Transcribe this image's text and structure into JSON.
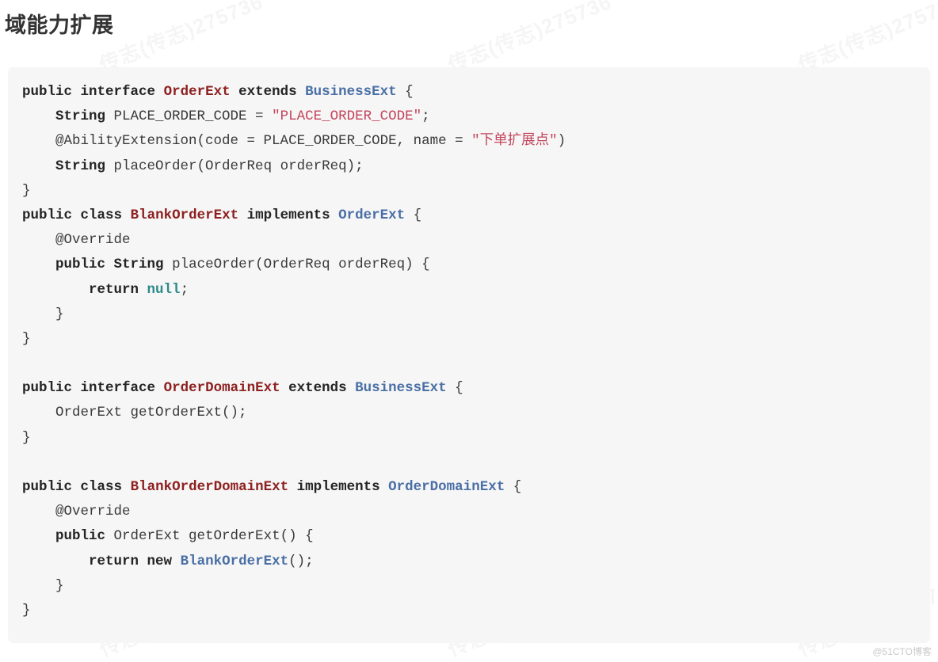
{
  "page": {
    "title": "域能力扩展",
    "footer_watermark": "@51CTO博客",
    "watermark_text": "传志(传志)275736",
    "background_color": "#ffffff",
    "code_background_color": "#f6f6f6"
  },
  "theme": {
    "title_color": "#333333",
    "code_text_color": "#303030",
    "keyword_color": "#242424",
    "declared_type_color": "#8e2020",
    "referenced_type_color": "#4a6fa5",
    "string_color": "#c4455c",
    "null_literal_color": "#2f8a8a"
  },
  "code": {
    "language": "java",
    "lines": [
      {
        "id": "l1",
        "tokens": [
          {
            "t": "public",
            "c": "kw"
          },
          {
            "t": " ",
            "c": "plain"
          },
          {
            "t": "interface",
            "c": "kw"
          },
          {
            "t": " ",
            "c": "plain"
          },
          {
            "t": "OrderExt",
            "c": "decl"
          },
          {
            "t": " ",
            "c": "plain"
          },
          {
            "t": "extends",
            "c": "kw"
          },
          {
            "t": " ",
            "c": "plain"
          },
          {
            "t": "BusinessExt",
            "c": "type"
          },
          {
            "t": " {",
            "c": "punct"
          }
        ]
      },
      {
        "id": "l2",
        "tokens": [
          {
            "t": "    ",
            "c": "plain"
          },
          {
            "t": "String",
            "c": "kw"
          },
          {
            "t": " PLACE_ORDER_CODE = ",
            "c": "plain"
          },
          {
            "t": "\"PLACE_ORDER_CODE\"",
            "c": "str"
          },
          {
            "t": ";",
            "c": "punct"
          }
        ]
      },
      {
        "id": "l3",
        "tokens": [
          {
            "t": "    ",
            "c": "plain"
          },
          {
            "t": "@AbilityExtension(code = PLACE_ORDER_CODE, name = ",
            "c": "anno"
          },
          {
            "t": "\"下单扩展点\"",
            "c": "str"
          },
          {
            "t": ")",
            "c": "punct"
          }
        ]
      },
      {
        "id": "l4",
        "tokens": [
          {
            "t": "    ",
            "c": "plain"
          },
          {
            "t": "String",
            "c": "kw"
          },
          {
            "t": " placeOrder(OrderReq orderReq);",
            "c": "plain"
          }
        ]
      },
      {
        "id": "l5",
        "tokens": [
          {
            "t": "}",
            "c": "punct"
          }
        ]
      },
      {
        "id": "l6",
        "tokens": [
          {
            "t": "public",
            "c": "kw"
          },
          {
            "t": " ",
            "c": "plain"
          },
          {
            "t": "class",
            "c": "kw"
          },
          {
            "t": " ",
            "c": "plain"
          },
          {
            "t": "BlankOrderExt",
            "c": "decl"
          },
          {
            "t": " ",
            "c": "plain"
          },
          {
            "t": "implements",
            "c": "kw"
          },
          {
            "t": " ",
            "c": "plain"
          },
          {
            "t": "OrderExt",
            "c": "type"
          },
          {
            "t": " {",
            "c": "punct"
          }
        ]
      },
      {
        "id": "l7",
        "tokens": [
          {
            "t": "    ",
            "c": "plain"
          },
          {
            "t": "@Override",
            "c": "anno"
          }
        ]
      },
      {
        "id": "l8",
        "tokens": [
          {
            "t": "    ",
            "c": "plain"
          },
          {
            "t": "public",
            "c": "kw"
          },
          {
            "t": " ",
            "c": "plain"
          },
          {
            "t": "String",
            "c": "kw"
          },
          {
            "t": " placeOrder(OrderReq orderReq) {",
            "c": "plain"
          }
        ]
      },
      {
        "id": "l9",
        "tokens": [
          {
            "t": "        ",
            "c": "plain"
          },
          {
            "t": "return",
            "c": "kw"
          },
          {
            "t": " ",
            "c": "plain"
          },
          {
            "t": "null",
            "c": "null"
          },
          {
            "t": ";",
            "c": "punct"
          }
        ]
      },
      {
        "id": "l10",
        "tokens": [
          {
            "t": "    }",
            "c": "punct"
          }
        ]
      },
      {
        "id": "l11",
        "tokens": [
          {
            "t": "}",
            "c": "punct"
          }
        ]
      },
      {
        "id": "l12",
        "tokens": [
          {
            "t": "",
            "c": "plain"
          }
        ]
      },
      {
        "id": "l13",
        "tokens": [
          {
            "t": "public",
            "c": "kw"
          },
          {
            "t": " ",
            "c": "plain"
          },
          {
            "t": "interface",
            "c": "kw"
          },
          {
            "t": " ",
            "c": "plain"
          },
          {
            "t": "OrderDomainExt",
            "c": "decl"
          },
          {
            "t": " ",
            "c": "plain"
          },
          {
            "t": "extends",
            "c": "kw"
          },
          {
            "t": " ",
            "c": "plain"
          },
          {
            "t": "BusinessExt",
            "c": "type"
          },
          {
            "t": " {",
            "c": "punct"
          }
        ]
      },
      {
        "id": "l14",
        "tokens": [
          {
            "t": "    OrderExt getOrderExt();",
            "c": "plain"
          }
        ]
      },
      {
        "id": "l15",
        "tokens": [
          {
            "t": "}",
            "c": "punct"
          }
        ]
      },
      {
        "id": "l16",
        "tokens": [
          {
            "t": "",
            "c": "plain"
          }
        ]
      },
      {
        "id": "l17",
        "tokens": [
          {
            "t": "public",
            "c": "kw"
          },
          {
            "t": " ",
            "c": "plain"
          },
          {
            "t": "class",
            "c": "kw"
          },
          {
            "t": " ",
            "c": "plain"
          },
          {
            "t": "BlankOrderDomainExt",
            "c": "decl"
          },
          {
            "t": " ",
            "c": "plain"
          },
          {
            "t": "implements",
            "c": "kw"
          },
          {
            "t": " ",
            "c": "plain"
          },
          {
            "t": "OrderDomainExt",
            "c": "type"
          },
          {
            "t": " {",
            "c": "punct"
          }
        ]
      },
      {
        "id": "l18",
        "tokens": [
          {
            "t": "    ",
            "c": "plain"
          },
          {
            "t": "@Override",
            "c": "anno"
          }
        ]
      },
      {
        "id": "l19",
        "tokens": [
          {
            "t": "    ",
            "c": "plain"
          },
          {
            "t": "public",
            "c": "kw"
          },
          {
            "t": " OrderExt getOrderExt() {",
            "c": "plain"
          }
        ]
      },
      {
        "id": "l20",
        "tokens": [
          {
            "t": "        ",
            "c": "plain"
          },
          {
            "t": "return",
            "c": "kw"
          },
          {
            "t": " ",
            "c": "plain"
          },
          {
            "t": "new",
            "c": "kw"
          },
          {
            "t": " ",
            "c": "plain"
          },
          {
            "t": "BlankOrderExt",
            "c": "type"
          },
          {
            "t": "();",
            "c": "punct"
          }
        ]
      },
      {
        "id": "l21",
        "tokens": [
          {
            "t": "    }",
            "c": "punct"
          }
        ]
      },
      {
        "id": "l22",
        "tokens": [
          {
            "t": "}",
            "c": "punct"
          }
        ]
      }
    ]
  }
}
